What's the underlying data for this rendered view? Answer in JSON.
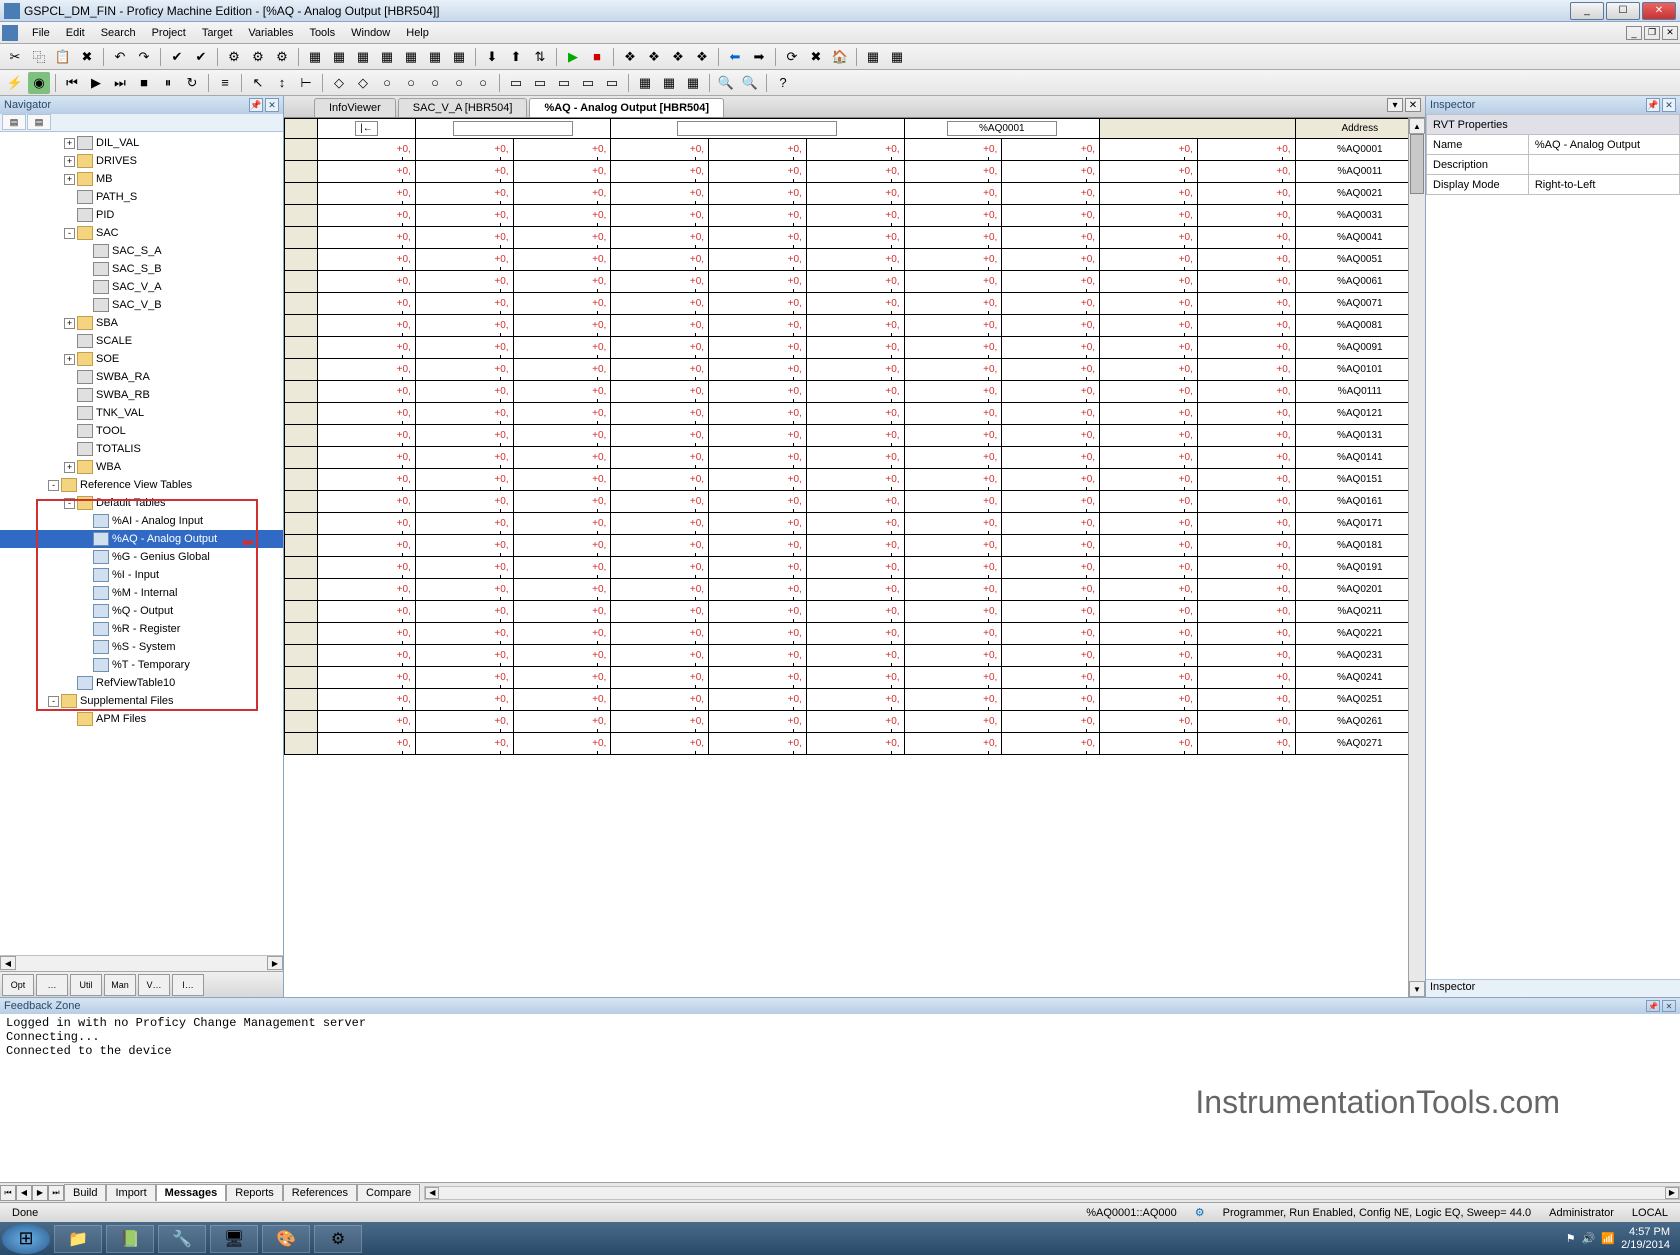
{
  "window": {
    "title": "GSPCL_DM_FIN - Proficy Machine Edition - [%AQ - Analog Output [HBR504]]"
  },
  "menu": [
    "File",
    "Edit",
    "Search",
    "Project",
    "Target",
    "Variables",
    "Tools",
    "Window",
    "Help"
  ],
  "navigator": {
    "title": "Navigator",
    "tree": [
      {
        "lv": 4,
        "icon": "block",
        "label": "DIL_VAL",
        "exp": "+"
      },
      {
        "lv": 4,
        "icon": "folder",
        "label": "DRIVES",
        "exp": "+"
      },
      {
        "lv": 4,
        "icon": "folder",
        "label": "MB",
        "exp": "+"
      },
      {
        "lv": 4,
        "icon": "block",
        "label": "PATH_S",
        "exp": ""
      },
      {
        "lv": 4,
        "icon": "block",
        "label": "PID",
        "exp": ""
      },
      {
        "lv": 4,
        "icon": "folder",
        "label": "SAC",
        "exp": "-"
      },
      {
        "lv": 5,
        "icon": "block",
        "label": "SAC_S_A",
        "exp": ""
      },
      {
        "lv": 5,
        "icon": "block",
        "label": "SAC_S_B",
        "exp": ""
      },
      {
        "lv": 5,
        "icon": "block",
        "label": "SAC_V_A",
        "exp": ""
      },
      {
        "lv": 5,
        "icon": "block",
        "label": "SAC_V_B",
        "exp": ""
      },
      {
        "lv": 4,
        "icon": "folder",
        "label": "SBA",
        "exp": "+"
      },
      {
        "lv": 4,
        "icon": "block",
        "label": "SCALE",
        "exp": ""
      },
      {
        "lv": 4,
        "icon": "folder",
        "label": "SOE",
        "exp": "+"
      },
      {
        "lv": 4,
        "icon": "block",
        "label": "SWBA_RA",
        "exp": ""
      },
      {
        "lv": 4,
        "icon": "block",
        "label": "SWBA_RB",
        "exp": ""
      },
      {
        "lv": 4,
        "icon": "block",
        "label": "TNK_VAL",
        "exp": ""
      },
      {
        "lv": 4,
        "icon": "block",
        "label": "TOOL",
        "exp": ""
      },
      {
        "lv": 4,
        "icon": "block",
        "label": "TOTALIS",
        "exp": ""
      },
      {
        "lv": 4,
        "icon": "folder",
        "label": "WBA",
        "exp": "+"
      },
      {
        "lv": 3,
        "icon": "folder",
        "label": "Reference View Tables",
        "exp": "-"
      },
      {
        "lv": 4,
        "icon": "folder",
        "label": "Default Tables",
        "exp": "-"
      },
      {
        "lv": 5,
        "icon": "table",
        "label": "%AI - Analog Input",
        "exp": ""
      },
      {
        "lv": 5,
        "icon": "table",
        "label": "%AQ - Analog Output",
        "exp": "",
        "selected": true
      },
      {
        "lv": 5,
        "icon": "table",
        "label": "%G - Genius Global",
        "exp": ""
      },
      {
        "lv": 5,
        "icon": "table",
        "label": "%I - Input",
        "exp": ""
      },
      {
        "lv": 5,
        "icon": "table",
        "label": "%M - Internal",
        "exp": ""
      },
      {
        "lv": 5,
        "icon": "table",
        "label": "%Q - Output",
        "exp": ""
      },
      {
        "lv": 5,
        "icon": "table",
        "label": "%R - Register",
        "exp": ""
      },
      {
        "lv": 5,
        "icon": "table",
        "label": "%S - System",
        "exp": ""
      },
      {
        "lv": 5,
        "icon": "table",
        "label": "%T - Temporary",
        "exp": ""
      },
      {
        "lv": 4,
        "icon": "table",
        "label": "RefViewTable10",
        "exp": ""
      },
      {
        "lv": 3,
        "icon": "folder",
        "label": "Supplemental Files",
        "exp": "-"
      },
      {
        "lv": 4,
        "icon": "folder",
        "label": "APM Files",
        "exp": ""
      }
    ],
    "bottom_tabs": [
      "Opt",
      "…",
      "Util",
      "Man",
      "V…",
      "I…"
    ]
  },
  "doc_tabs": [
    {
      "label": "InfoViewer",
      "active": false
    },
    {
      "label": "SAC_V_A [HBR504]",
      "active": false
    },
    {
      "label": "%AQ - Analog Output [HBR504]",
      "active": true
    }
  ],
  "grid": {
    "goto_label": "|←",
    "addr_input": "%AQ0001",
    "addr_header": "Address",
    "cols": 10,
    "cell_value": "+0",
    "rows": [
      "%AQ0001",
      "%AQ0011",
      "%AQ0021",
      "%AQ0031",
      "%AQ0041",
      "%AQ0051",
      "%AQ0061",
      "%AQ0071",
      "%AQ0081",
      "%AQ0091",
      "%AQ0101",
      "%AQ0111",
      "%AQ0121",
      "%AQ0131",
      "%AQ0141",
      "%AQ0151",
      "%AQ0161",
      "%AQ0171",
      "%AQ0181",
      "%AQ0191",
      "%AQ0201",
      "%AQ0211",
      "%AQ0221",
      "%AQ0231",
      "%AQ0241",
      "%AQ0251",
      "%AQ0261",
      "%AQ0271"
    ]
  },
  "inspector": {
    "title": "Inspector",
    "section": "RVT Properties",
    "rows": [
      {
        "k": "Name",
        "v": "%AQ - Analog Output"
      },
      {
        "k": "Description",
        "v": ""
      },
      {
        "k": "Display Mode",
        "v": "Right-to-Left"
      }
    ],
    "bottom_tab": "Inspector"
  },
  "feedback": {
    "title": "Feedback Zone",
    "lines": [
      "Logged in with no Proficy Change Management server",
      "Connecting...",
      "Connected to the device"
    ],
    "watermark": "InstrumentationTools.com",
    "tabs": [
      "Build",
      "Import",
      "Messages",
      "Reports",
      "References",
      "Compare"
    ],
    "active_tab": "Messages"
  },
  "status": {
    "left": "Done",
    "addr": "%AQ0001::AQ000",
    "mode": "Programmer, Run Enabled, Config NE, Logic EQ, Sweep= 44.0",
    "user": "Administrator",
    "scope": "LOCAL"
  },
  "taskbar": {
    "time": "4:57 PM",
    "date": "2/19/2014"
  }
}
